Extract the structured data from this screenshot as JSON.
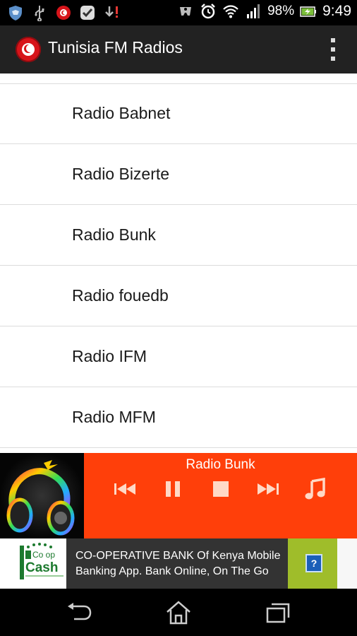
{
  "status_bar": {
    "battery_percent": "98%",
    "time": "9:49",
    "icons": [
      "shield-icon",
      "usb-icon",
      "tunisia-flag-notification-icon",
      "check-icon",
      "download-alert-icon",
      "controller-icon",
      "alarm-icon",
      "wifi-icon",
      "signal-icon",
      "battery-charging-icon"
    ]
  },
  "app_bar": {
    "title": "Tunisia FM Radios",
    "icons": [
      "app-flag-icon",
      "overflow-menu-icon"
    ]
  },
  "stations": [
    {
      "label": "Radio Babnet"
    },
    {
      "label": "Radio Bizerte"
    },
    {
      "label": "Radio Bunk"
    },
    {
      "label": "Radio fouedb"
    },
    {
      "label": "Radio IFM"
    },
    {
      "label": "Radio MFM"
    }
  ],
  "player": {
    "now_playing": "Radio Bunk",
    "accent_color": "#ff3f0a",
    "controls": [
      "previous-icon",
      "pause-icon",
      "stop-icon",
      "next-icon",
      "music-note-icon"
    ]
  },
  "ad": {
    "logo_brand": "M Co-op Cash",
    "text": "CO-OPERATIVE BANK Of Kenya Mobile Banking App. Bank Online, On The Go",
    "info_label": "?"
  },
  "nav_bar": {
    "icons": [
      "back-icon",
      "home-icon",
      "recent-apps-icon"
    ]
  },
  "colors": {
    "status_bar": "#000000",
    "action_bar": "#222222",
    "player_accent": "#ff3f0a",
    "ad_background": "#333333",
    "ad_info_green": "#9fbd2a"
  }
}
